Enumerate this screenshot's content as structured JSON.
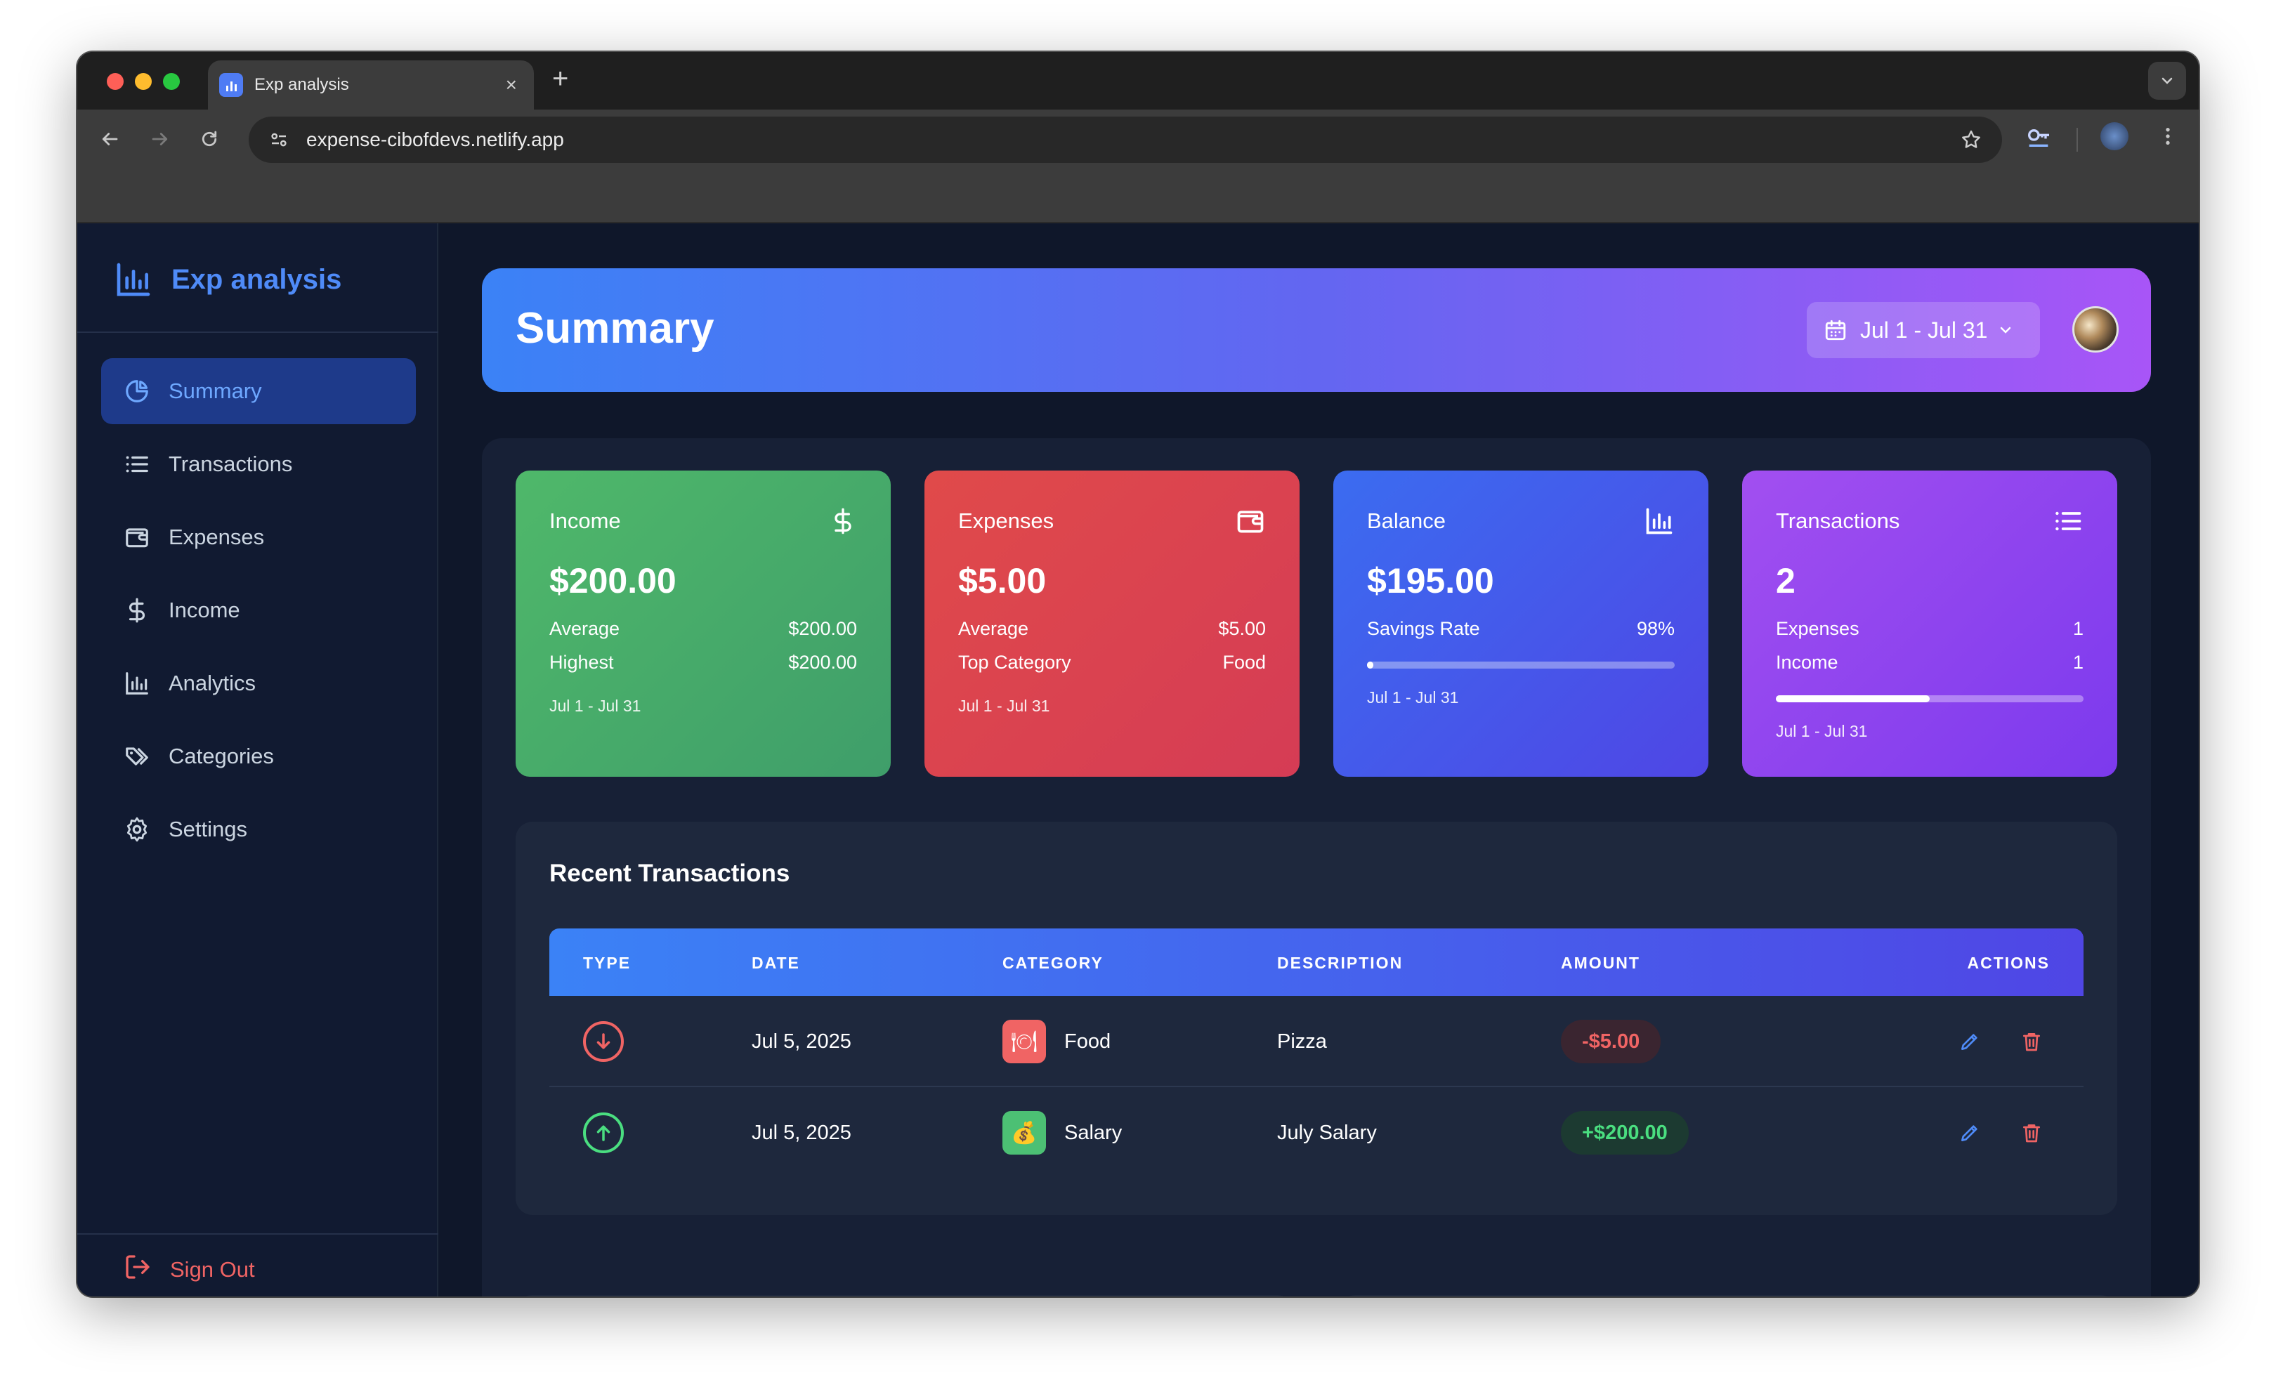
{
  "browser": {
    "tab_title": "Exp analysis",
    "url": "expense-cibofdevs.netlify.app",
    "new_tab_symbol": "+",
    "close_symbol": "×"
  },
  "sidebar": {
    "brand": "Exp analysis",
    "items": [
      {
        "label": "Summary",
        "icon": "pie-chart-icon",
        "active": true
      },
      {
        "label": "Transactions",
        "icon": "list-icon"
      },
      {
        "label": "Expenses",
        "icon": "wallet-icon"
      },
      {
        "label": "Income",
        "icon": "dollar-icon"
      },
      {
        "label": "Analytics",
        "icon": "bar-chart-icon"
      },
      {
        "label": "Categories",
        "icon": "tags-icon"
      },
      {
        "label": "Settings",
        "icon": "gear-icon"
      }
    ],
    "sign_out": "Sign Out"
  },
  "header": {
    "title": "Summary",
    "date_range": "Jul 1 - Jul 31"
  },
  "cards": {
    "income": {
      "title": "Income",
      "value": "$200.00",
      "row1_label": "Average",
      "row1_value": "$200.00",
      "row2_label": "Highest",
      "row2_value": "$200.00",
      "footer": "Jul 1 - Jul 31",
      "colors": [
        "#4fb86a",
        "#3f9e6a"
      ]
    },
    "expenses": {
      "title": "Expenses",
      "value": "$5.00",
      "row1_label": "Average",
      "row1_value": "$5.00",
      "row2_label": "Top Category",
      "row2_value": "Food",
      "footer": "Jul 1 - Jul 31",
      "colors": [
        "#e04a4a",
        "#d53c55"
      ]
    },
    "balance": {
      "title": "Balance",
      "value": "$195.00",
      "row1_label": "Savings Rate",
      "row1_value": "98%",
      "savings_fraction": 0.02,
      "footer": "Jul 1 - Jul 31",
      "colors": [
        "#3b6cf0",
        "#4f46e5"
      ]
    },
    "transactions": {
      "title": "Transactions",
      "value": "2",
      "row1_label": "Expenses",
      "row1_value": "1",
      "row2_label": "Income",
      "row2_value": "1",
      "ratio_fraction": 0.5,
      "footer": "Jul 1 - Jul 31",
      "colors": [
        "#a24ff0",
        "#7c3aed"
      ]
    }
  },
  "recent": {
    "title": "Recent Transactions",
    "columns": [
      "TYPE",
      "DATE",
      "CATEGORY",
      "DESCRIPTION",
      "AMOUNT",
      "ACTIONS"
    ],
    "rows": [
      {
        "type": "expense",
        "date": "Jul 5, 2025",
        "category": "Food",
        "category_icon": "🍽",
        "description": "Pizza",
        "amount": "-$5.00"
      },
      {
        "type": "income",
        "date": "Jul 5, 2025",
        "category": "Salary",
        "category_icon": "💰",
        "description": "July Salary",
        "amount": "+$200.00"
      }
    ]
  },
  "colors": {
    "accent": "#4f8bf8",
    "expense": "#f06464",
    "income": "#4ade80",
    "background": "#0f172a"
  }
}
